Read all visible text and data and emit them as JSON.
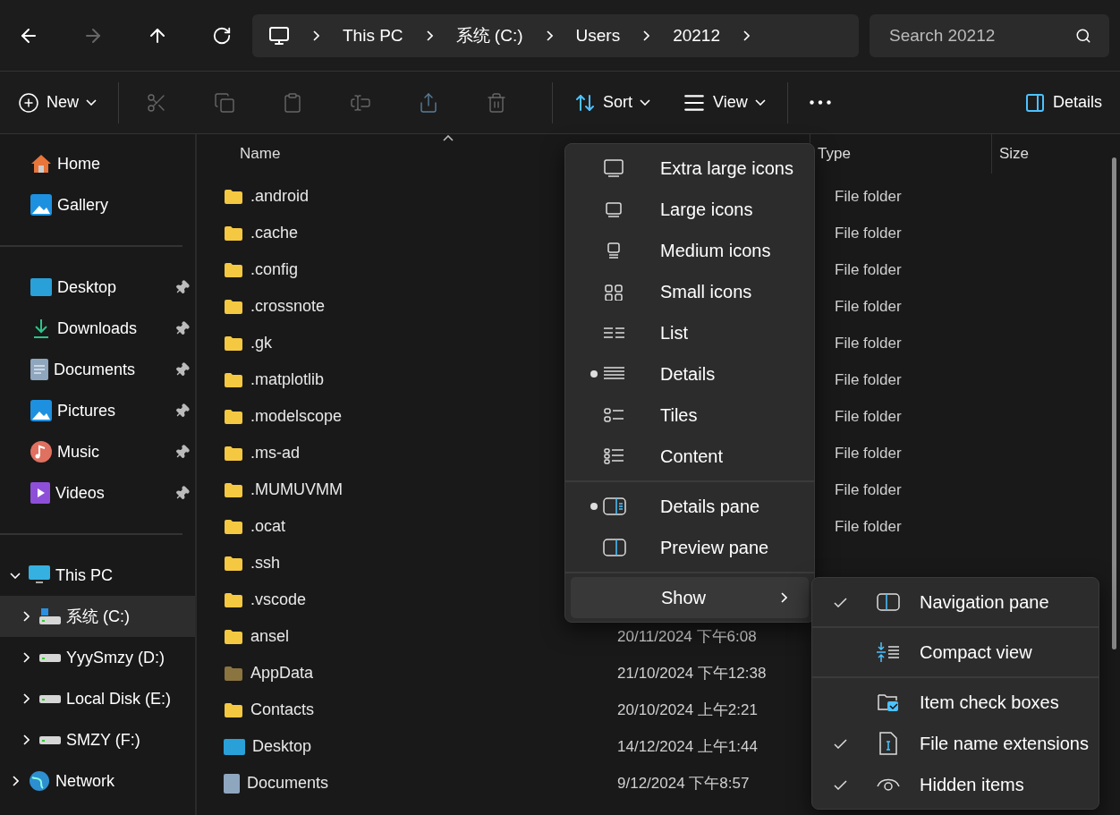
{
  "nav": {
    "back_disabled": false,
    "forward_disabled": true
  },
  "address": {
    "crumbs": [
      "This PC",
      "系统 (C:)",
      "Users",
      "20212"
    ]
  },
  "search": {
    "placeholder": "Search 20212"
  },
  "toolbar": {
    "new": "New",
    "actions": [
      {
        "disabled": true
      },
      {
        "disabled": true
      },
      {
        "disabled": true
      },
      {
        "disabled": true
      },
      {
        "disabled": true
      },
      {
        "disabled": true
      }
    ],
    "sort": "Sort",
    "view": "View",
    "details": "Details"
  },
  "sidebar": {
    "quick": [
      {
        "label": "Home"
      },
      {
        "label": "Gallery"
      }
    ],
    "pinned": [
      {
        "label": "Desktop",
        "pinned": true
      },
      {
        "label": "Downloads",
        "pinned": true
      },
      {
        "label": "Documents",
        "pinned": true
      },
      {
        "label": "Pictures",
        "pinned": true
      },
      {
        "label": "Music",
        "pinned": true
      },
      {
        "label": "Videos",
        "pinned": true
      }
    ],
    "tree": [
      {
        "label": "This PC",
        "expanded": true,
        "selected": false,
        "children": [
          {
            "label": "系统 (C:)",
            "expanded": false,
            "selected": true
          },
          {
            "label": "YyySmzy (D:)",
            "expanded": false,
            "selected": false
          },
          {
            "label": "Local Disk (E:)",
            "expanded": false,
            "selected": false
          },
          {
            "label": "SMZY (F:)",
            "expanded": false,
            "selected": false
          }
        ]
      },
      {
        "label": "Network",
        "expanded": false,
        "selected": false
      }
    ]
  },
  "table": {
    "columns": [
      {
        "label": "Name",
        "sorted": true
      },
      {
        "label": "Type",
        "sorted": false
      },
      {
        "label": "Size",
        "sorted": false
      }
    ],
    "rows": [
      {
        "kind": "folder",
        "name": ".android",
        "type": "File folder"
      },
      {
        "kind": "folder",
        "name": ".cache",
        "type": "File folder"
      },
      {
        "kind": "folder",
        "name": ".config",
        "type": "File folder"
      },
      {
        "kind": "folder",
        "name": ".crossnote",
        "type": "File folder"
      },
      {
        "kind": "folder",
        "name": ".gk",
        "type": "File folder"
      },
      {
        "kind": "folder",
        "name": ".matplotlib",
        "type": "File folder"
      },
      {
        "kind": "folder",
        "name": ".modelscope",
        "type": "File folder"
      },
      {
        "kind": "folder",
        "name": ".ms-ad",
        "type": "File folder"
      },
      {
        "kind": "folder",
        "name": ".MUMUVMM",
        "type": "File folder"
      },
      {
        "kind": "folder",
        "name": ".ocat",
        "type": "File folder"
      },
      {
        "kind": "folder",
        "name": ".ssh"
      },
      {
        "kind": "folder",
        "name": ".vscode"
      },
      {
        "kind": "folder",
        "name": "ansel",
        "date": "20/11/2024 下午6:08"
      },
      {
        "kind": "hidden-folder",
        "name": "AppData",
        "date": "21/10/2024 下午12:38"
      },
      {
        "kind": "folder",
        "name": "Contacts",
        "date": "20/10/2024 上午2:21"
      },
      {
        "kind": "desktop",
        "name": "Desktop",
        "date": "14/12/2024 上午1:44"
      },
      {
        "kind": "documents",
        "name": "Documents",
        "date": "9/12/2024 下午8:57"
      }
    ]
  },
  "view_menu": {
    "sections": [
      [
        {
          "label": "Extra large icons",
          "selected": false
        },
        {
          "label": "Large icons",
          "selected": false
        },
        {
          "label": "Medium icons",
          "selected": false
        },
        {
          "label": "Small icons",
          "selected": false
        },
        {
          "label": "List",
          "selected": false
        },
        {
          "label": "Details",
          "selected": true
        },
        {
          "label": "Tiles",
          "selected": false
        },
        {
          "label": "Content",
          "selected": false
        }
      ],
      [
        {
          "label": "Details pane",
          "selected": true
        },
        {
          "label": "Preview pane",
          "selected": false
        }
      ]
    ],
    "show": {
      "label": "Show",
      "expanded": true
    }
  },
  "show_menu": {
    "sections": [
      [
        {
          "label": "Navigation pane",
          "checked": true
        }
      ],
      [
        {
          "label": "Compact view",
          "checked": false
        }
      ],
      [
        {
          "label": "Item check boxes",
          "checked": false
        },
        {
          "label": "File name extensions",
          "checked": true
        },
        {
          "label": "Hidden items",
          "checked": true
        }
      ]
    ]
  }
}
